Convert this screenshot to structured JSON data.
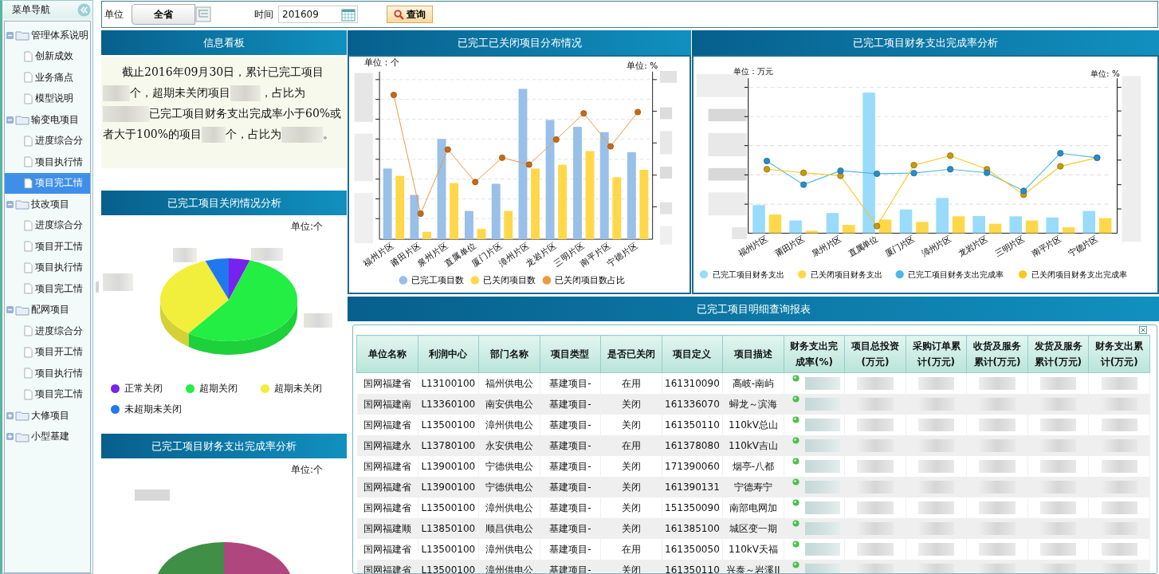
{
  "sidebar": {
    "title": "菜单导航",
    "items": [
      {
        "label": "管理体系说明",
        "expanded": true,
        "selected": false,
        "children": [
          {
            "label": "创新成效",
            "selected": false
          },
          {
            "label": "业务痛点",
            "selected": false
          },
          {
            "label": "模型说明",
            "selected": false
          }
        ]
      },
      {
        "label": "输变电项目",
        "expanded": true,
        "selected": false,
        "children": [
          {
            "label": "进度综合分",
            "selected": false
          },
          {
            "label": "项目执行情",
            "selected": false
          },
          {
            "label": "项目完工情",
            "selected": true
          }
        ]
      },
      {
        "label": "技改项目",
        "expanded": true,
        "selected": false,
        "children": [
          {
            "label": "进度综合分",
            "selected": false
          },
          {
            "label": "项目开工情",
            "selected": false
          },
          {
            "label": "项目执行情",
            "selected": false
          },
          {
            "label": "项目完工情",
            "selected": false
          }
        ]
      },
      {
        "label": "配网项目",
        "expanded": true,
        "selected": false,
        "children": [
          {
            "label": "进度综合分",
            "selected": false
          },
          {
            "label": "项目开工情",
            "selected": false
          },
          {
            "label": "项目执行情",
            "selected": false
          },
          {
            "label": "项目完工情",
            "selected": false
          }
        ]
      },
      {
        "label": "大修项目",
        "expanded": false,
        "selected": false
      },
      {
        "label": "小型基建",
        "expanded": false,
        "selected": false
      }
    ]
  },
  "toolbar": {
    "unit_label": "单位",
    "unit_button": "全省",
    "time_label": "时间",
    "time_value": "201609",
    "query_button": "查询"
  },
  "info_panel": {
    "title": "信息看板",
    "text_parts": [
      "截止2016年09月30日，累计已完工项目",
      "个，超期未关闭项目",
      "，占比为",
      "已完工项目财务支出完成率小于60%或者大于100%的项目",
      "个，占比为",
      "。"
    ]
  },
  "closure_pie": {
    "title": "已完工项目关闭情况分析",
    "unit": "单位:个",
    "legend": [
      {
        "label": "正常关闭",
        "color": "#7722ee"
      },
      {
        "label": "超期关闭",
        "color": "#22ee44"
      },
      {
        "label": "超期未关闭",
        "color": "#f2ee3c"
      },
      {
        "label": "未超期未关闭",
        "color": "#1f78f0"
      }
    ]
  },
  "finance_pie": {
    "title": "已完工项目财务支出完成率分析",
    "unit": "单位:个"
  },
  "distribution_chart": {
    "title": "已完工已关闭项目分布情况",
    "unit_left": "单位：个",
    "unit_right": "单位: %",
    "categories": [
      "福州片区",
      "莆田片区",
      "泉州片区",
      "直属单位",
      "厦门片区",
      "漳州片区",
      "龙岩片区",
      "三明片区",
      "南平片区",
      "宁德片区"
    ],
    "legend": [
      {
        "label": "已完工项目数",
        "color": "#99c0e8"
      },
      {
        "label": "已关闭项目数",
        "color": "#ffd84a"
      },
      {
        "label": "已关闭项目数占比",
        "color": "#ea9a44"
      }
    ]
  },
  "finance_chart": {
    "title": "已完工项目财务支出完成率分析",
    "unit_left": "单位：万元",
    "unit_right": "单位: %",
    "categories": [
      "福州片区",
      "莆田片区",
      "泉州片区",
      "直属单位",
      "厦门片区",
      "漳州片区",
      "龙岩片区",
      "三明片区",
      "南平片区",
      "宁德片区"
    ],
    "legend": [
      {
        "label": "已完工项目财务支出",
        "color": "#99dbfa"
      },
      {
        "label": "已关闭项目财务支出",
        "color": "#ffd84a"
      },
      {
        "label": "已完工项目财务支出完成率",
        "color": "#4cb8ea"
      },
      {
        "label": "已关闭项目财务支出完成率",
        "color": "#f8c820"
      }
    ]
  },
  "report": {
    "title": "已完工项目明细查询报表",
    "columns": [
      "单位名称",
      "利润中心",
      "部门名称",
      "项目类型",
      "是否已关闭",
      "项目定义",
      "项目描述",
      "财务支出完成率(%)",
      "项目总投资(万元)",
      "采购订单累计(万元)",
      "收货及服务累计(万元)",
      "发货及服务累计(万元)",
      "财务支出累计(万元)"
    ],
    "rows": [
      {
        "cells": [
          "国网福建省",
          "L13100100",
          "福州供电公",
          "基建项目-",
          "在用",
          "161310090",
          "高岐-南屿"
        ]
      },
      {
        "cells": [
          "国网福建南",
          "L13360100",
          "南安供电公",
          "基建项目-",
          "关闭",
          "161336070",
          "蟳龙～滨海"
        ]
      },
      {
        "cells": [
          "国网福建省",
          "L13500100",
          "漳州供电公",
          "基建项目-",
          "关闭",
          "161350110",
          "110kV总山"
        ]
      },
      {
        "cells": [
          "国网福建永",
          "L13780100",
          "永安供电公",
          "基建项目-",
          "在用",
          "161378080",
          "110kV吉山"
        ]
      },
      {
        "cells": [
          "国网福建省",
          "L13900100",
          "宁德供电公",
          "基建项目-",
          "关闭",
          "171390060",
          "烟亭-八都"
        ]
      },
      {
        "cells": [
          "国网福建省",
          "L13900100",
          "宁德供电公",
          "基建项目-",
          "关闭",
          "161390131",
          "宁德寿宁"
        ]
      },
      {
        "cells": [
          "国网福建省",
          "L13500100",
          "漳州供电公",
          "基建项目-",
          "关闭",
          "151350090",
          "南部电网加"
        ]
      },
      {
        "cells": [
          "国网福建顺",
          "L13850100",
          "顺昌供电公",
          "基建项目-",
          "关闭",
          "161385100",
          "城区变一期"
        ]
      },
      {
        "cells": [
          "国网福建省",
          "L13500100",
          "漳州供电公",
          "基建项目-",
          "在用",
          "161350050",
          "110kV天福"
        ]
      },
      {
        "cells": [
          "国网福建省",
          "L13500100",
          "漳州供电公",
          "基建项目-",
          "关闭",
          "161350110",
          "兴泰～岩溪II"
        ]
      }
    ]
  }
}
